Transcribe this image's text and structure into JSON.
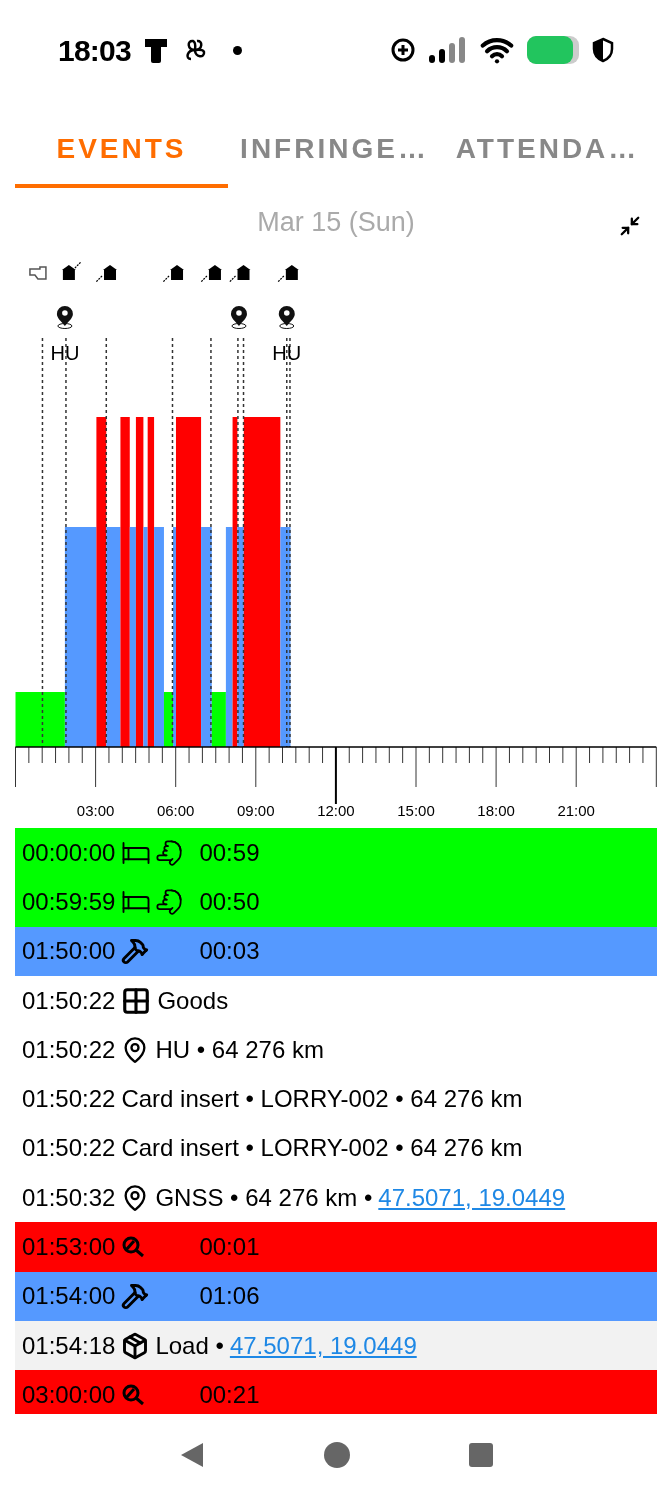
{
  "status_bar": {
    "time": "18:03"
  },
  "tabs": [
    {
      "label": "EVENTS",
      "selected": true
    },
    {
      "label": "INFRINGE…",
      "selected": false
    },
    {
      "label": "ATTENDA…",
      "selected": false
    }
  ],
  "date": "Mar 15 (Sun)",
  "timeline": {
    "axis_labels": [
      "03:00",
      "06:00",
      "09:00",
      "12:00",
      "15:00",
      "18:00",
      "21:00"
    ],
    "place_labels": [
      "HU",
      "HU"
    ]
  },
  "events": [
    {
      "time": "00:00:00",
      "kind": "rest",
      "duration": "00:59",
      "color": "#00ff00",
      "selected": false
    },
    {
      "time": "00:59:59",
      "kind": "rest",
      "duration": "00:50",
      "color": "#00ff00",
      "selected": false
    },
    {
      "time": "01:50:00",
      "kind": "work",
      "duration": "00:03",
      "color": "#5599ff",
      "selected": false
    },
    {
      "time": "01:50:22",
      "kind": "goods",
      "text": "Goods",
      "color": "#ffffff",
      "selected": false
    },
    {
      "time": "01:50:22",
      "kind": "place",
      "text": "HU • 64 276 km",
      "color": "#ffffff",
      "selected": false
    },
    {
      "time": "01:50:22",
      "kind": "card",
      "text": "Card insert • LORRY-002 • 64 276 km",
      "color": "#ffffff",
      "selected": false
    },
    {
      "time": "01:50:22",
      "kind": "card",
      "text": "Card insert • LORRY-002 • 64 276 km",
      "color": "#ffffff",
      "selected": false
    },
    {
      "time": "01:50:32",
      "kind": "place",
      "text": "GNSS • 64 276 km •",
      "link": "47.5071, 19.0449",
      "color": "#ffffff",
      "selected": false
    },
    {
      "time": "01:53:00",
      "kind": "driving",
      "duration": "00:01",
      "color": "#ff0000",
      "selected": false
    },
    {
      "time": "01:54:00",
      "kind": "work",
      "duration": "01:06",
      "color": "#5599ff",
      "selected": false
    },
    {
      "time": "01:54:18",
      "kind": "load",
      "text": "Load •",
      "link": "47.5071, 19.0449",
      "selected": true
    },
    {
      "time": "03:00:00",
      "kind": "driving",
      "duration": "00:21",
      "color": "#ff0000",
      "selected": false
    }
  ]
}
